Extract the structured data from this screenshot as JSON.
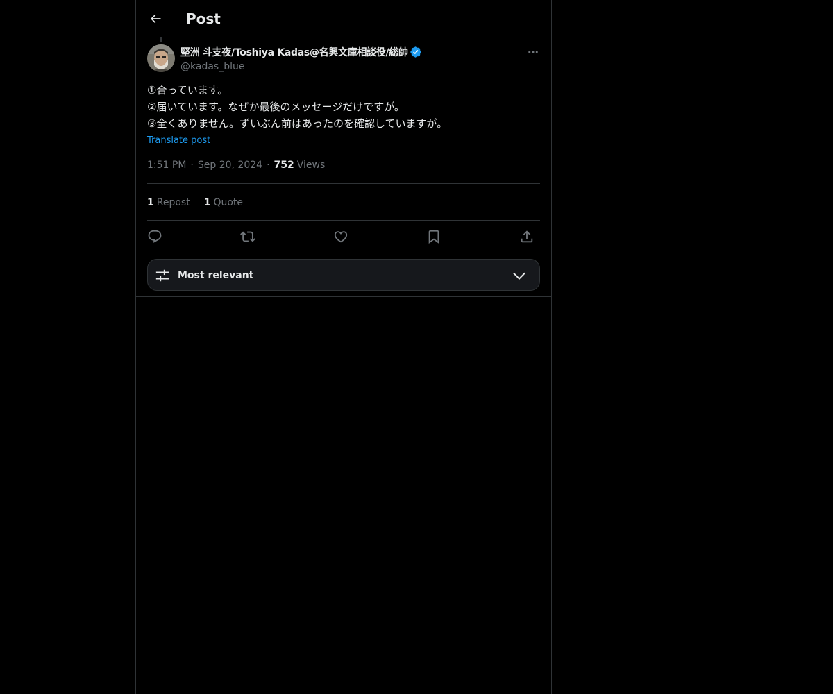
{
  "header": {
    "title": "Post",
    "back_icon": "arrow-left-icon"
  },
  "author": {
    "name": "堅洲 斗支夜/Toshiya Kadas@名興文庫相談役/総帥",
    "handle": "@kadas_blue",
    "verified": true,
    "verified_color": "#1d9bf0"
  },
  "post": {
    "lines": [
      "①合っています。",
      "②届いています。なぜか最後のメッセージだけですが。",
      "③全くありません。ずいぶん前はあったのを確認していますが。"
    ],
    "translate_label": "Translate post",
    "time": "1:51 PM",
    "date": "Sep 20, 2024",
    "separator": "·",
    "views_count": "752",
    "views_label": "Views"
  },
  "stats": {
    "reposts_count": "1",
    "reposts_label": "Repost",
    "quotes_count": "1",
    "quotes_label": "Quote"
  },
  "actions": {
    "icons": [
      "reply-icon",
      "repost-icon",
      "like-icon",
      "bookmark-icon",
      "share-icon"
    ]
  },
  "sort": {
    "label": "Most relevant",
    "icon": "sliders-icon",
    "chevron": "chevron-down-icon"
  },
  "colors": {
    "background": "#000000",
    "text": "#e7e9ea",
    "secondary": "#71767b",
    "accent": "#1d9bf0",
    "border": "#2f3336"
  }
}
